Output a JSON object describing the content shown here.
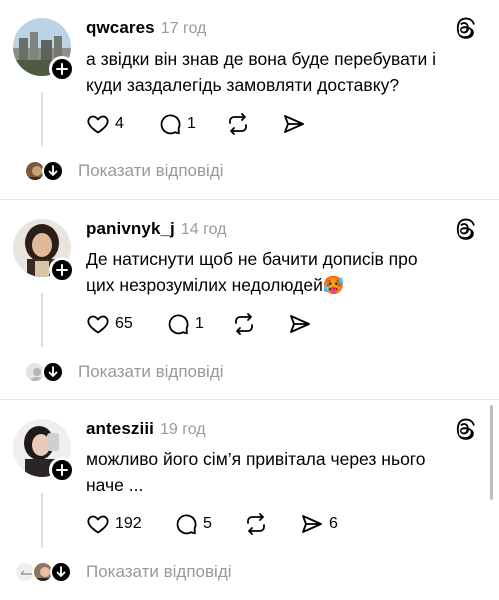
{
  "comments": [
    {
      "username": "qwcares",
      "time": "17 год",
      "text_line1": "а звідки він знав де вона буде перебувати і",
      "text_line2": "куди заздалегідь замовляти доставку?",
      "likes": "4",
      "replies": "1",
      "reposts": "",
      "shares": "",
      "show_replies_label": "Показати відповіді"
    },
    {
      "username": "panivnyk_j",
      "time": "14 год",
      "text_line1": "Де натиснути щоб не бачити дописів про",
      "text_line2": "цих незрозумілих недолюдей",
      "emoji": "🥵",
      "likes": "65",
      "replies": "1",
      "reposts": "",
      "shares": "",
      "show_replies_label": "Показати відповіді"
    },
    {
      "username": "antesziii",
      "time": "19 год",
      "text_line1": "можливо його сім’я привітала через нього",
      "text_line2": "наче ...",
      "likes": "192",
      "replies": "5",
      "reposts": "",
      "shares": "6",
      "show_replies_label": "Показати відповіді"
    }
  ],
  "icons": {
    "like": "heart-outline-icon",
    "reply": "comment-bubble-icon",
    "repost": "repost-arrows-icon",
    "share": "send-paper-plane-icon",
    "threads": "threads-logo-icon",
    "follow": "plus-icon",
    "expand": "arrow-down-icon"
  },
  "colors": {
    "text": "#000000",
    "muted": "#999999",
    "divider": "#e6e6e6",
    "thread_line": "#dcdcdc"
  }
}
